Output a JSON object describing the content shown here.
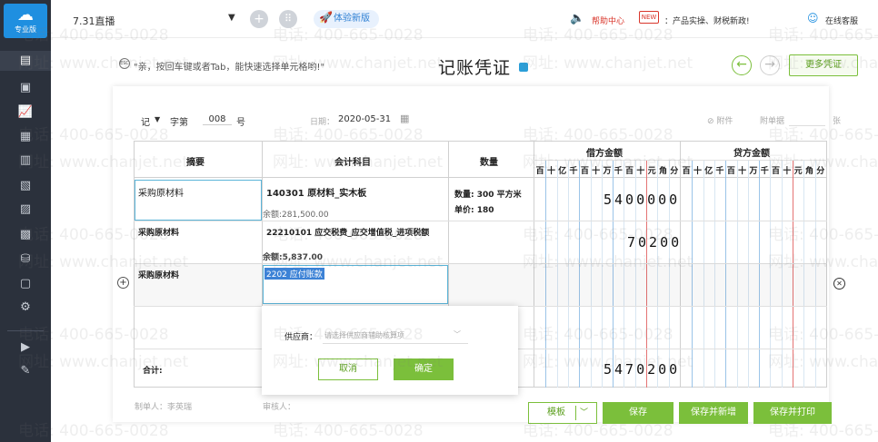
{
  "sidebar": {
    "logo_text": "专业版",
    "icons": [
      "ledger-icon",
      "voucher-icon",
      "chart-icon",
      "report-icon",
      "calendar-icon",
      "book-icon",
      "table-icon",
      "image-icon",
      "stamp-icon",
      "document-icon",
      "settings-icon",
      "play-icon",
      "edit-icon"
    ]
  },
  "topbar": {
    "account": "7.31直播",
    "try_new": "体验新版",
    "help": "帮助中心",
    "news": "：产品实操、财税新政!",
    "online_service": "在线客服"
  },
  "header": {
    "hint_icon": "ESC",
    "hint": "\"亲，按回车键或者Tab，能快速选择单元格哟!\"",
    "title": "记账凭证",
    "more_vouchers": "更多凭证"
  },
  "voucher": {
    "word_type": "记",
    "word_label": "字第",
    "number": "008",
    "number_suffix": "号",
    "date_label": "日期：",
    "date": "2020-05-31",
    "attach_label": "附件",
    "attach_docs": "附单据",
    "sheets": "张",
    "columns": {
      "summary": "摘要",
      "account": "会计科目",
      "quantity": "数量",
      "debit": "借方金额",
      "credit": "贷方金额"
    },
    "units": [
      "百",
      "十",
      "亿",
      "千",
      "百",
      "十",
      "万",
      "千",
      "百",
      "十",
      "元",
      "角",
      "分"
    ],
    "rows": [
      {
        "summary": "采购原材料",
        "account": "140301 原材料_实木板",
        "balance": "余额:281,500.00",
        "qty_label": "数量: 300 平方米",
        "price_label": "单价: 180",
        "debit": "5400000"
      },
      {
        "summary": "采购原材料",
        "account": "22210101 应交税费_应交增值税_进项税额",
        "balance": "余额:5,837.00",
        "debit": "70200"
      },
      {
        "summary": "采购原材料",
        "account": "2202  应付账款"
      }
    ],
    "total_label": "合计:",
    "total_debit": "5470200",
    "maker_label": "制单人：李英瑞",
    "auditor_label": "审核人："
  },
  "popup": {
    "supplier_label": "供应商：",
    "supplier_placeholder": "请选择供应商辅助核算项",
    "cancel": "取消",
    "confirm": "确定"
  },
  "actions": {
    "template": "模板",
    "save": "保存",
    "save_new": "保存并新增",
    "save_print": "保存并打印"
  },
  "watermark": {
    "phone": "电话: 400-665-0028",
    "site": "网址: www.chanjet.net"
  },
  "colors": {
    "sidebar_bg": "#2b313c",
    "accent_green": "#7bbf3b",
    "brand_blue": "#1f8fe0",
    "highlight_red": "#d9362b"
  }
}
